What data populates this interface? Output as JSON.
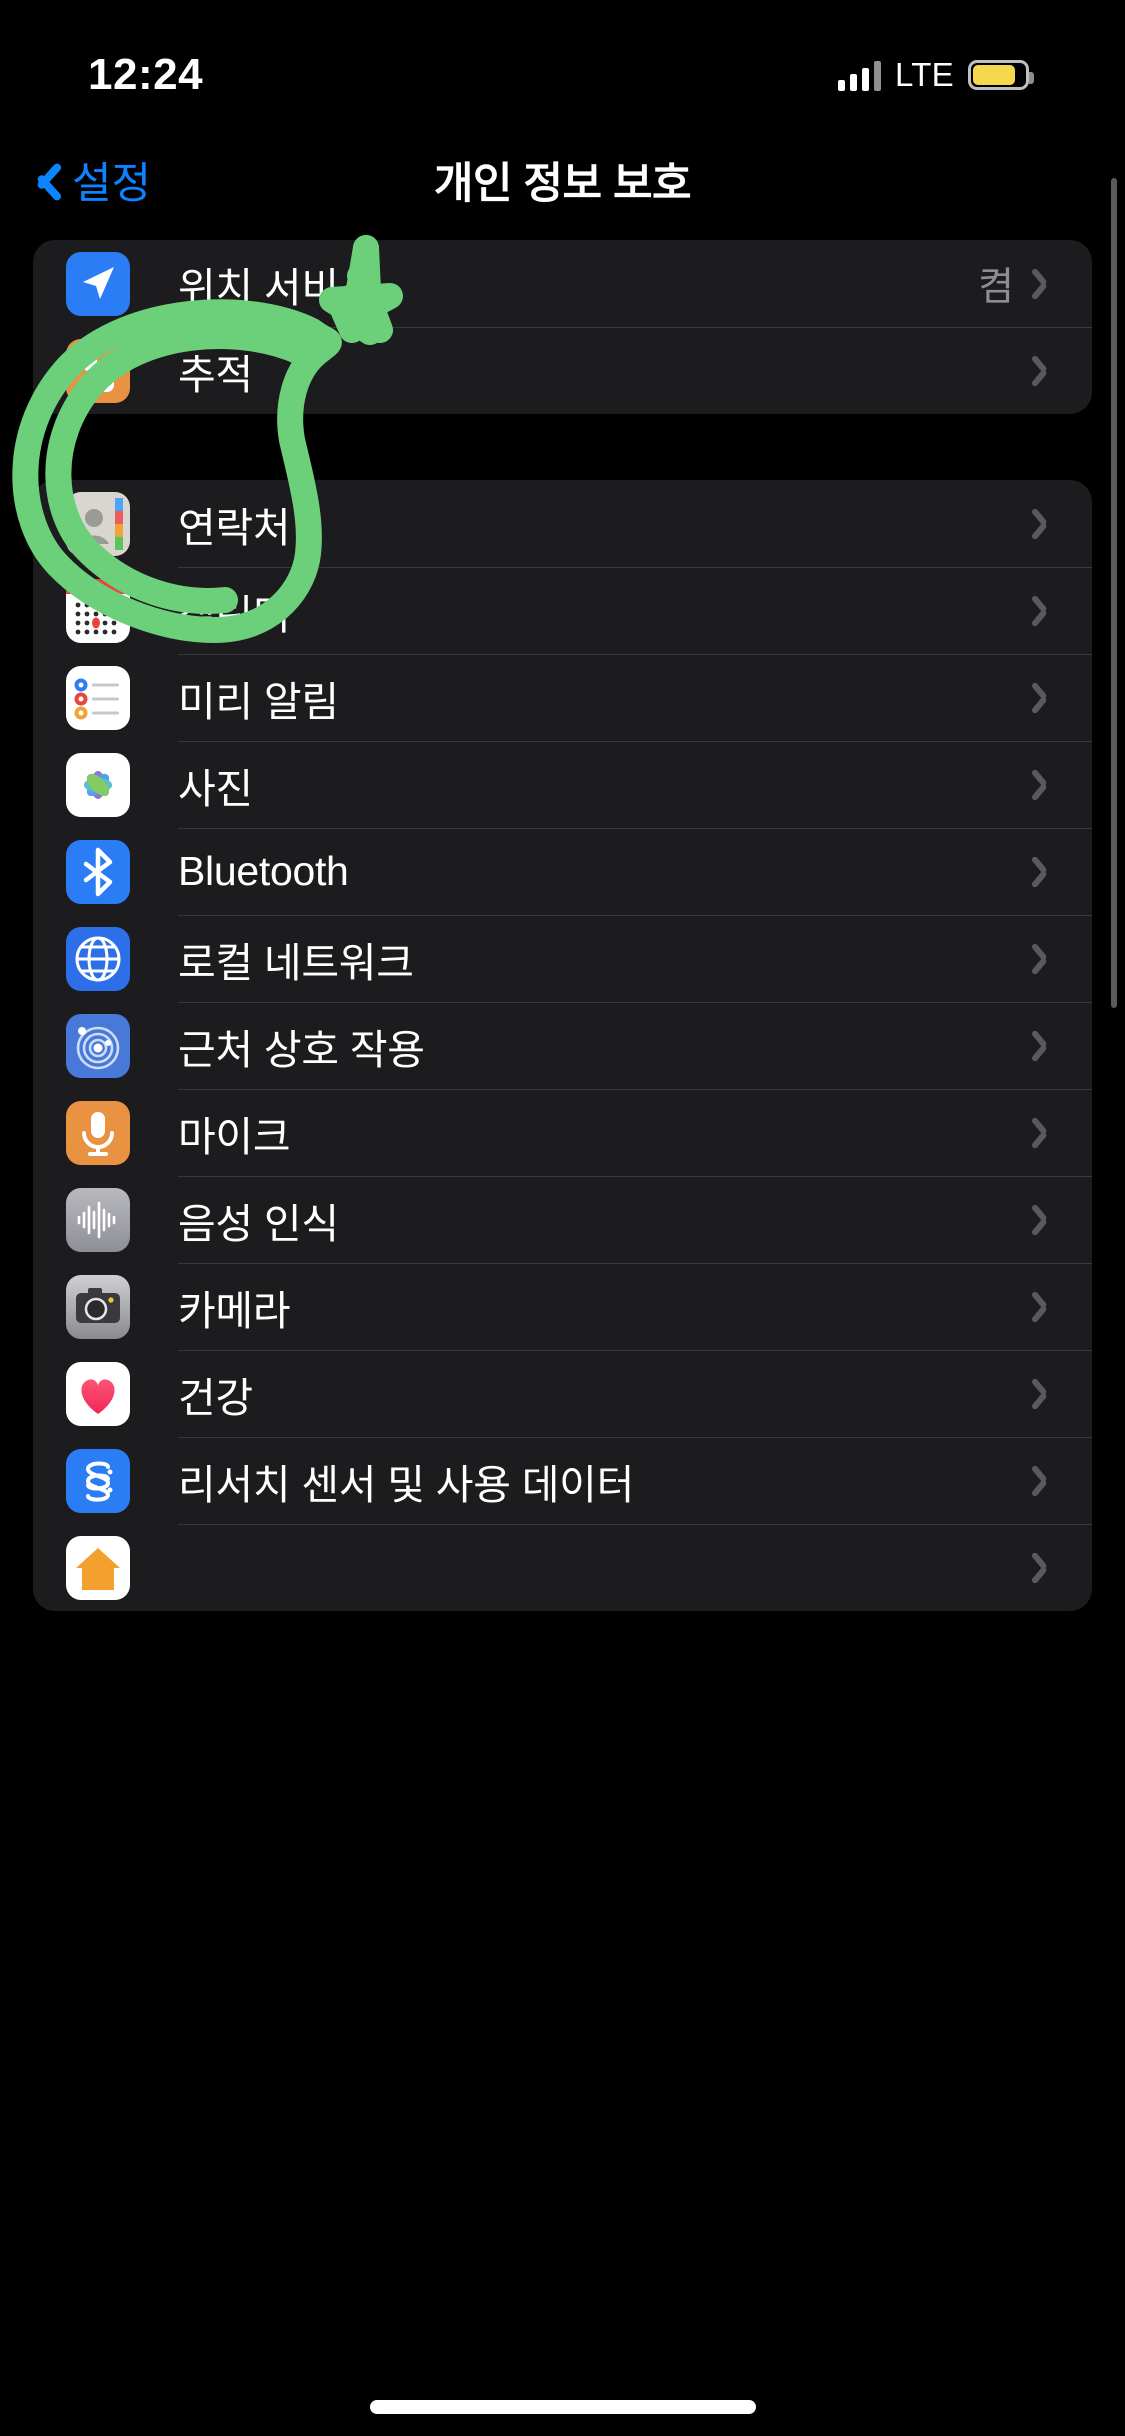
{
  "status_bar": {
    "time": "12:24",
    "carrier_network": "LTE",
    "signal_icon": "cellular-bars-icon",
    "battery_icon": "battery-low-power-icon",
    "battery_color": "#F5D84B"
  },
  "nav": {
    "back_label": "설정",
    "back_icon": "chevron-left-icon",
    "title": "개인 정보 보호"
  },
  "accent_color": "#0A84FF",
  "group_1": {
    "rows": [
      {
        "label": "위치 서비스",
        "value": "켬",
        "icon": "location-arrow-icon",
        "icon_class": "ic-location"
      },
      {
        "label": "추적",
        "value": "",
        "icon": "tracking-icon",
        "icon_class": "ic-tracking"
      }
    ]
  },
  "group_2": {
    "rows": [
      {
        "label": "연락처",
        "value": "",
        "icon": "contacts-icon",
        "icon_class": "ic-contacts"
      },
      {
        "label": "캘린더",
        "value": "",
        "icon": "calendar-icon",
        "icon_class": "ic-calendar"
      },
      {
        "label": "미리 알림",
        "value": "",
        "icon": "reminders-icon",
        "icon_class": "ic-reminders"
      },
      {
        "label": "사진",
        "value": "",
        "icon": "photos-icon",
        "icon_class": "ic-photos"
      },
      {
        "label": "Bluetooth",
        "value": "",
        "icon": "bluetooth-icon",
        "icon_class": "ic-bluetooth"
      },
      {
        "label": "로컬 네트워크",
        "value": "",
        "icon": "globe-icon",
        "icon_class": "ic-localnet"
      },
      {
        "label": "근처 상호 작용",
        "value": "",
        "icon": "nearby-interaction-icon",
        "icon_class": "ic-nearby"
      },
      {
        "label": "마이크",
        "value": "",
        "icon": "microphone-icon",
        "icon_class": "ic-mic"
      },
      {
        "label": "음성 인식",
        "value": "",
        "icon": "waveform-icon",
        "icon_class": "ic-speech"
      },
      {
        "label": "카메라",
        "value": "",
        "icon": "camera-icon",
        "icon_class": "ic-camera"
      },
      {
        "label": "건강",
        "value": "",
        "icon": "heart-icon",
        "icon_class": "ic-health"
      },
      {
        "label": "리서치 센서 및 사용 데이터",
        "value": "",
        "icon": "research-icon",
        "icon_class": "ic-research"
      },
      {
        "label": "",
        "value": "",
        "icon": "home-icon",
        "icon_class": "ic-home"
      }
    ]
  },
  "annotations": {
    "color": "#6CD07A",
    "shapes": [
      "ellipse-highlight-around-tracking-row",
      "star-mark-near-location-services"
    ]
  }
}
